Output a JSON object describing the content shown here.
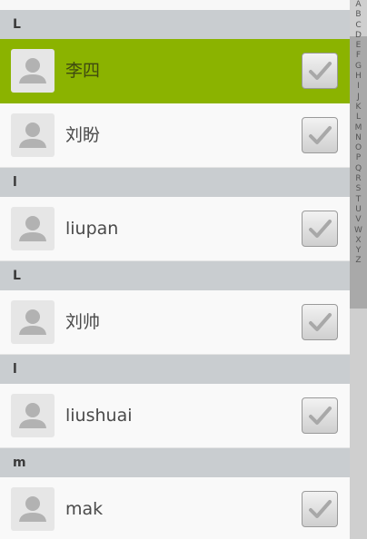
{
  "sections": [
    {
      "header": "L",
      "contacts": [
        {
          "name": "李四",
          "selected": true
        }
      ]
    },
    {
      "header": "",
      "contacts": [
        {
          "name": "刘盼",
          "selected": false
        }
      ]
    },
    {
      "header": "l",
      "contacts": [
        {
          "name": "liupan",
          "selected": false
        }
      ]
    },
    {
      "header": "L",
      "contacts": [
        {
          "name": "刘帅",
          "selected": false
        }
      ]
    },
    {
      "header": "l",
      "contacts": [
        {
          "name": "liushuai",
          "selected": false
        }
      ]
    },
    {
      "header": "m",
      "contacts": [
        {
          "name": "mak",
          "selected": false
        }
      ]
    }
  ],
  "index_letters": [
    "A",
    "B",
    "C",
    "D",
    "E",
    "F",
    "G",
    "H",
    "I",
    "J",
    "K",
    "L",
    "M",
    "N",
    "O",
    "P",
    "Q",
    "R",
    "S",
    "T",
    "U",
    "V",
    "W",
    "X",
    "Y",
    "Z"
  ],
  "colors": {
    "selected_row": "#8bb300",
    "section_header": "#c9cdd0",
    "index_bar": "#cfcfcf"
  },
  "icons": {
    "avatar": "person-silhouette-icon",
    "checkbox": "checkmark-icon"
  }
}
